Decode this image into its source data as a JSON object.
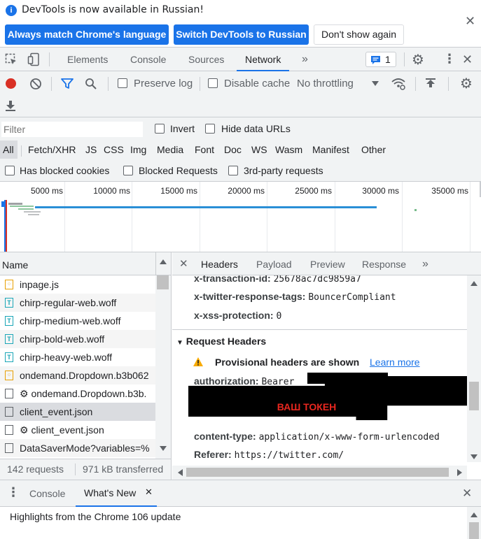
{
  "infobar": {
    "message": "DevTools is now available in Russian!",
    "btn_match": "Always match Chrome's language",
    "btn_switch": "Switch DevTools to Russian",
    "btn_dismiss": "Don't show again"
  },
  "tabs": {
    "elements": "Elements",
    "console": "Console",
    "sources": "Sources",
    "network": "Network",
    "more": "»",
    "issues_count": "1"
  },
  "toolbar": {
    "preserve_log": "Preserve log",
    "disable_cache": "Disable cache",
    "throttling": "No throttling"
  },
  "filter": {
    "placeholder": "Filter",
    "invert": "Invert",
    "hide_data_urls": "Hide data URLs",
    "types": [
      "All",
      "Fetch/XHR",
      "JS",
      "CSS",
      "Img",
      "Media",
      "Font",
      "Doc",
      "WS",
      "Wasm",
      "Manifest",
      "Other"
    ],
    "blocked_cookies": "Has blocked cookies",
    "blocked_requests": "Blocked Requests",
    "third_party": "3rd-party requests"
  },
  "overview": {
    "ticks": [
      "5000 ms",
      "10000 ms",
      "15000 ms",
      "20000 ms",
      "25000 ms",
      "30000 ms",
      "35000 ms"
    ]
  },
  "requests": {
    "header": "Name",
    "items": [
      {
        "name": "inpage.js",
        "type": "js"
      },
      {
        "name": "chirp-regular-web.woff",
        "type": "font"
      },
      {
        "name": "chirp-medium-web.woff",
        "type": "font"
      },
      {
        "name": "chirp-bold-web.woff",
        "type": "font"
      },
      {
        "name": "chirp-heavy-web.woff",
        "type": "font"
      },
      {
        "name": "ondemand.Dropdown.b3b062",
        "type": "js"
      },
      {
        "name": "⚙ ondemand.Dropdown.b3b.",
        "type": "doc"
      },
      {
        "name": "client_event.json",
        "type": "doc"
      },
      {
        "name": "⚙ client_event.json",
        "type": "doc"
      },
      {
        "name": "DataSaverMode?variables=%",
        "type": "doc"
      }
    ],
    "count": "142 requests",
    "transferred": "971 kB transferred"
  },
  "detail_tabs": {
    "headers": "Headers",
    "payload": "Payload",
    "preview": "Preview",
    "response": "Response",
    "more": "»"
  },
  "response_headers": [
    {
      "key": "x-transaction-id:",
      "value": "25678ac7dc9859a7"
    },
    {
      "key": "x-twitter-response-tags:",
      "value": "BouncerCompliant"
    },
    {
      "key": "x-xss-protection:",
      "value": "0"
    }
  ],
  "request_headers": {
    "title": "Request Headers",
    "provisional": "Provisional headers are shown",
    "learn_more": "Learn more",
    "auth_key": "authorization:",
    "auth_value": "Bearer",
    "token_label": "ВАШ ТОКЕН",
    "ct_key": "content-type:",
    "ct_value": "application/x-www-form-urlencoded",
    "ref_key": "Referer:",
    "ref_value": "https://twitter.com/"
  },
  "drawer": {
    "console": "Console",
    "whats_new": "What's New",
    "highlights": "Highlights from the Chrome 106 update"
  },
  "colors": {
    "accent": "#1a73e8",
    "record": "#d93025",
    "font_icon": "#1aa6b7",
    "js_icon": "#e8a000"
  }
}
